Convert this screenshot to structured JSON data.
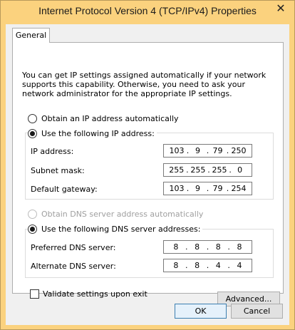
{
  "window": {
    "title": "Internet Protocol Version 4 (TCP/IPv4) Properties",
    "close_glyph": "✕"
  },
  "tabs": [
    {
      "label": "General",
      "selected": true
    }
  ],
  "general": {
    "description": "You can get IP settings assigned automatically if your network supports this capability. Otherwise, you need to ask your network administrator for the appropriate IP settings.",
    "ip_mode": {
      "auto_label": "Obtain an IP address automatically",
      "auto_selected": false,
      "manual_label": "Use the following IP address:",
      "manual_selected": true
    },
    "ip_fields": {
      "ip_address": {
        "label": "IP address:",
        "octets": [
          "103",
          "9",
          "79",
          "250"
        ]
      },
      "subnet_mask": {
        "label": "Subnet mask:",
        "octets": [
          "255",
          "255",
          "255",
          "0"
        ]
      },
      "default_gateway": {
        "label": "Default gateway:",
        "octets": [
          "103",
          "9",
          "79",
          "254"
        ]
      }
    },
    "dns_mode": {
      "auto_label": "Obtain DNS server address automatically",
      "auto_selected": false,
      "auto_enabled": false,
      "manual_label": "Use the following DNS server addresses:",
      "manual_selected": true
    },
    "dns_fields": {
      "preferred": {
        "label": "Preferred DNS server:",
        "octets": [
          "8",
          "8",
          "8",
          "8"
        ]
      },
      "alternate": {
        "label": "Alternate DNS server:",
        "octets": [
          "8",
          "8",
          "4",
          "4"
        ]
      }
    },
    "validate_label": "Validate settings upon exit",
    "validate_checked": false,
    "advanced_label": "Advanced..."
  },
  "footer": {
    "ok_label": "OK",
    "cancel_label": "Cancel"
  },
  "colors": {
    "title_bar": "#fbd27e",
    "client_bg": "#f0f0f0",
    "default_button_border": "#3c7fb1"
  }
}
